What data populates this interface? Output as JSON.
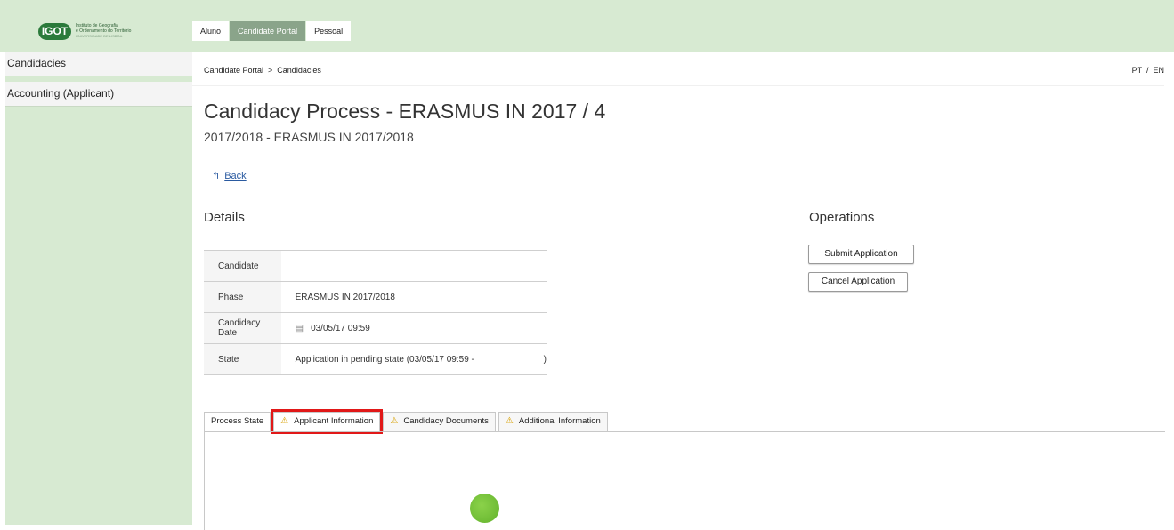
{
  "header": {
    "logo_badge": "IGOT",
    "logo_line1": "Instituto de Geografia",
    "logo_line2": "e Ordenamento do Território",
    "logo_line3": "UNIVERSIDADE DE LISBOA",
    "tabs": [
      {
        "label": "Aluno"
      },
      {
        "label": "Candidate Portal"
      },
      {
        "label": "Pessoal"
      }
    ]
  },
  "sidebar": {
    "items": [
      {
        "label": "Candidacies"
      },
      {
        "label": "Accounting (Applicant)"
      }
    ]
  },
  "breadcrumb": {
    "text": "Candidate Portal  >  Candidacies"
  },
  "language": "PT  /  EN",
  "page": {
    "title": "Candidacy Process - ERASMUS IN 2017 / 4",
    "subtitle": "2017/2018 - ERASMUS IN 2017/2018",
    "back_label": "Back"
  },
  "details": {
    "heading": "Details",
    "rows": [
      {
        "label": "Candidate",
        "value": ""
      },
      {
        "label": "Phase",
        "value": "ERASMUS IN 2017/2018"
      },
      {
        "label": "Candidacy Date",
        "value": "03/05/17 09:59"
      },
      {
        "label": "State",
        "value": "Application in pending state (03/05/17 09:59 -                            )"
      }
    ]
  },
  "operations": {
    "heading": "Operations",
    "submit_label": "Submit Application",
    "cancel_label": "Cancel Application"
  },
  "tabs": [
    {
      "label": "Process State"
    },
    {
      "label": "Applicant Information"
    },
    {
      "label": "Candidacy Documents"
    },
    {
      "label": "Additional Information"
    }
  ],
  "colors": {
    "header_bg": "#d7ead2",
    "active_tab_bg": "#8aa48a",
    "highlight": "#e11818",
    "warning": "#d8a000",
    "link": "#2a5aa0"
  }
}
